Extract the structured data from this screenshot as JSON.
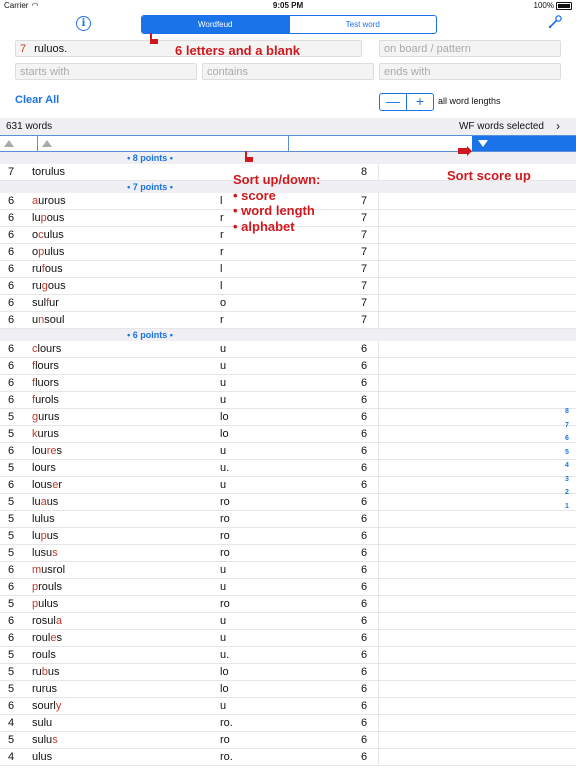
{
  "status_bar": {
    "carrier": "Carrier",
    "time": "9:05 PM",
    "battery": "100%"
  },
  "header": {
    "tabs": [
      {
        "label": "Wordfeud",
        "selected": true
      },
      {
        "label": "Test word",
        "selected": false
      }
    ]
  },
  "search": {
    "rack_count": "7",
    "rack_letters": "ruluos.",
    "on_board_placeholder": "on board / pattern",
    "starts_with_placeholder": "starts with",
    "contains_placeholder": "contains",
    "ends_with_placeholder": "ends with"
  },
  "controls": {
    "clear_all": "Clear All",
    "stepper_minus": "—",
    "stepper_plus": "+",
    "word_lengths": "all word lengths"
  },
  "summary": {
    "count": "631 words",
    "selection": "WF words selected",
    "chevron": "›"
  },
  "annotations": {
    "blank_note": "6 letters and a blank",
    "sort_title": "Sort up/down:",
    "sort_items": [
      "• score",
      "• word length",
      "• alphabet"
    ],
    "sort_score_up": "Sort score up"
  },
  "index_letters": [
    "8",
    "7",
    "6",
    "5",
    "4",
    "3",
    "2",
    "1"
  ],
  "colors": {
    "accent": "#1a73e8",
    "highlight": "#c0392b",
    "annotation": "#d0191e",
    "header_bg": "#efeff4"
  },
  "sections": [
    {
      "label": "• 8 points •",
      "rows": [
        {
          "score": "7",
          "pre": "",
          "hl": "",
          "post": "torulus",
          "extra": "",
          "len": "8"
        }
      ]
    },
    {
      "label": "• 7 points •",
      "rows": [
        {
          "score": "6",
          "pre": "",
          "hl": "a",
          "post": "urous",
          "extra": "l",
          "len": "7"
        },
        {
          "score": "6",
          "pre": "lu",
          "hl": "p",
          "post": "ous",
          "extra": "r",
          "len": "7"
        },
        {
          "score": "6",
          "pre": "o",
          "hl": "c",
          "post": "ulus",
          "extra": "r",
          "len": "7"
        },
        {
          "score": "6",
          "pre": "o",
          "hl": "p",
          "post": "ulus",
          "extra": "r",
          "len": "7"
        },
        {
          "score": "6",
          "pre": "ru",
          "hl": "f",
          "post": "ous",
          "extra": "l",
          "len": "7"
        },
        {
          "score": "6",
          "pre": "ru",
          "hl": "g",
          "post": "ous",
          "extra": "l",
          "len": "7"
        },
        {
          "score": "6",
          "pre": "sul",
          "hl": "f",
          "post": "ur",
          "extra": "o",
          "len": "7"
        },
        {
          "score": "6",
          "pre": "u",
          "hl": "n",
          "post": "soul",
          "extra": "r",
          "len": "7"
        }
      ]
    },
    {
      "label": "• 6 points •",
      "rows": [
        {
          "score": "6",
          "pre": "",
          "hl": "c",
          "post": "lours",
          "extra": "u",
          "len": "6"
        },
        {
          "score": "6",
          "pre": "",
          "hl": "f",
          "post": "lours",
          "extra": "u",
          "len": "6"
        },
        {
          "score": "6",
          "pre": "",
          "hl": "f",
          "post": "luors",
          "extra": "u",
          "len": "6"
        },
        {
          "score": "6",
          "pre": "",
          "hl": "f",
          "post": "urols",
          "extra": "u",
          "len": "6"
        },
        {
          "score": "5",
          "pre": "",
          "hl": "g",
          "post": "urus",
          "extra": "lo",
          "len": "6"
        },
        {
          "score": "5",
          "pre": "",
          "hl": "k",
          "post": "urus",
          "extra": "lo",
          "len": "6"
        },
        {
          "score": "6",
          "pre": "lou",
          "hl": "re",
          "post": "s",
          "extra": "u",
          "len": "6"
        },
        {
          "score": "5",
          "pre": "lours",
          "hl": "",
          "post": "",
          "extra": "u.",
          "len": "6"
        },
        {
          "score": "6",
          "pre": "lous",
          "hl": "e",
          "post": "r",
          "extra": "u",
          "len": "6"
        },
        {
          "score": "5",
          "pre": "lu",
          "hl": "a",
          "post": "us",
          "extra": "ro",
          "len": "6"
        },
        {
          "score": "5",
          "pre": "lulus",
          "hl": "",
          "post": "",
          "extra": "ro",
          "len": "6"
        },
        {
          "score": "5",
          "pre": "lu",
          "hl": "p",
          "post": "us",
          "extra": "ro",
          "len": "6"
        },
        {
          "score": "5",
          "pre": "lusu",
          "hl": "s",
          "post": "",
          "extra": "ro",
          "len": "6"
        },
        {
          "score": "6",
          "pre": "",
          "hl": "m",
          "post": "usrol",
          "extra": "u",
          "len": "6"
        },
        {
          "score": "6",
          "pre": "",
          "hl": "p",
          "post": "rouls",
          "extra": "u",
          "len": "6"
        },
        {
          "score": "5",
          "pre": "",
          "hl": "p",
          "post": "ulus",
          "extra": "ro",
          "len": "6"
        },
        {
          "score": "6",
          "pre": "rosul",
          "hl": "a",
          "post": "",
          "extra": "u",
          "len": "6"
        },
        {
          "score": "6",
          "pre": "roul",
          "hl": "e",
          "post": "s",
          "extra": "u",
          "len": "6"
        },
        {
          "score": "5",
          "pre": "rouls",
          "hl": "",
          "post": "",
          "extra": "u.",
          "len": "6"
        },
        {
          "score": "5",
          "pre": "ru",
          "hl": "b",
          "post": "us",
          "extra": "lo",
          "len": "6"
        },
        {
          "score": "5",
          "pre": "rurus",
          "hl": "",
          "post": "",
          "extra": "lo",
          "len": "6"
        },
        {
          "score": "6",
          "pre": "sourl",
          "hl": "y",
          "post": "",
          "extra": "u",
          "len": "6"
        },
        {
          "score": "4",
          "pre": "sulu",
          "hl": "",
          "post": "",
          "extra": "ro.",
          "len": "6"
        },
        {
          "score": "5",
          "pre": "sulu",
          "hl": "s",
          "post": "",
          "extra": "ro",
          "len": "6"
        },
        {
          "score": "4",
          "pre": "ulus",
          "hl": "",
          "post": "",
          "extra": "ro.",
          "len": "6"
        }
      ]
    }
  ]
}
